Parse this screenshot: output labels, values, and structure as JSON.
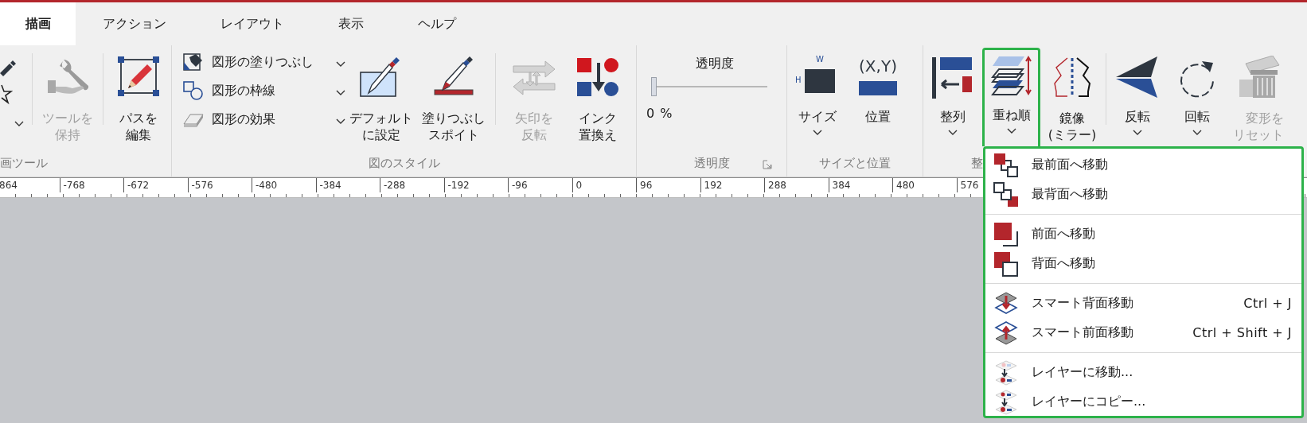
{
  "tabs": [
    {
      "label": "描画",
      "selected": true
    },
    {
      "label": "アクション",
      "selected": false
    },
    {
      "label": "レイアウト",
      "selected": false
    },
    {
      "label": "表示",
      "selected": false
    },
    {
      "label": "ヘルプ",
      "selected": false
    }
  ],
  "drawing_tools": {
    "label": "画ツール",
    "keep_tool": {
      "label": "ツールを保持",
      "disabled": true
    },
    "edit_path": {
      "label": "パスを編集",
      "disabled": false
    }
  },
  "style": {
    "label": "図のスタイル",
    "rows": [
      {
        "label": "図形の塗りつぶし"
      },
      {
        "label": "図形の枠線"
      },
      {
        "label": "図形の効果"
      }
    ],
    "set_default": {
      "label": "デフォルトに設定",
      "disabled": false
    },
    "eyedropper": {
      "label": "塗りつぶしスポイト",
      "disabled": false
    },
    "reverse_arrow": {
      "label": "矢印を反転",
      "disabled": true
    },
    "replace_ink": {
      "label": "インク置換え",
      "disabled": false
    }
  },
  "transparency": {
    "title": "透明度",
    "level": 0,
    "reading": "0 %",
    "label": "透明度"
  },
  "size_position": {
    "label": "サイズと位置",
    "size": {
      "label": "サイズ",
      "width_mark": "W",
      "height_mark": "H"
    },
    "position": {
      "label": "位置",
      "glyph": "(X,Y)"
    }
  },
  "arrange": {
    "label": "整",
    "align": {
      "label": "整列"
    },
    "order": {
      "label": "重ね順",
      "highlight": true
    },
    "mirror": {
      "label": "鏡像\n(ミラー)"
    },
    "flip": {
      "label": "反転"
    },
    "rotate": {
      "label": "回転"
    },
    "reset": {
      "label": "変形をリセット",
      "disabled": true
    }
  },
  "ruler": [
    "864",
    "-768",
    "-672",
    "-576",
    "-480",
    "-384",
    "-288",
    "-192",
    "-96",
    "0",
    "96",
    "192",
    "288",
    "384",
    "480",
    "576"
  ],
  "menu": {
    "highlight": true,
    "sections": [
      [
        {
          "label": "最前面へ移動"
        },
        {
          "label": "最背面へ移動"
        }
      ],
      [
        {
          "label": "前面へ移動"
        },
        {
          "label": "背面へ移動"
        }
      ],
      [
        {
          "label": "スマート背面移動",
          "shortcut": "Ctrl + J"
        },
        {
          "label": "スマート前面移動",
          "shortcut": "Ctrl + Shift + J"
        }
      ],
      [
        {
          "label": "レイヤーに移動..."
        },
        {
          "label": "レイヤーにコピー..."
        }
      ]
    ]
  }
}
